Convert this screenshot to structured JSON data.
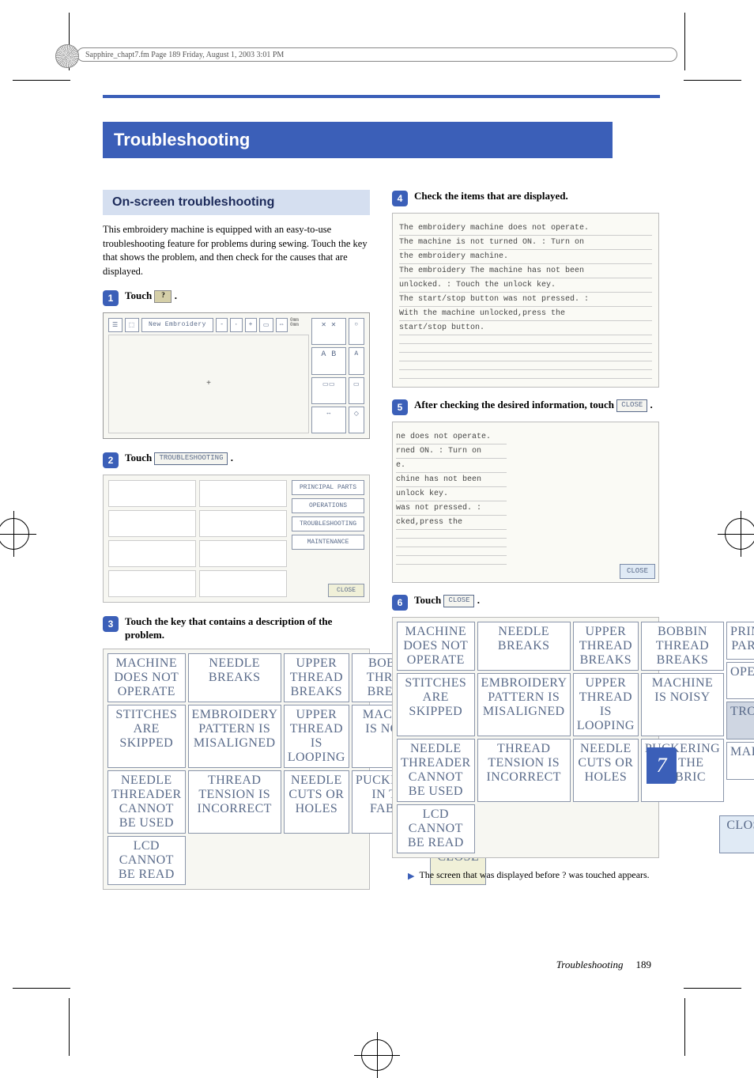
{
  "header_text": "Sapphire_chapt7.fm  Page 189  Friday, August 1, 2003  3:01 PM",
  "section_title": "Troubleshooting",
  "sub_heading": "On-screen troubleshooting",
  "intro": "This embroidery machine is equipped with an easy-to-use troubleshooting feature for problems during sewing. Touch the key that shows the problem, and then check for the causes that are displayed.",
  "steps": {
    "s1": {
      "label": "Touch",
      "button": "?",
      "suffix": "."
    },
    "s2": {
      "label": "Touch",
      "button": "TROUBLESHOOTING",
      "suffix": "."
    },
    "s3": {
      "label": "Touch the key that contains a description of the problem."
    },
    "s4": {
      "label": "Check the items that are displayed."
    },
    "s5": {
      "label": "After checking the desired information, touch",
      "button": "CLOSE",
      "suffix": "."
    },
    "s6": {
      "label": "Touch",
      "button": "CLOSE",
      "suffix": "."
    }
  },
  "menu_buttons": {
    "principal_parts": "PRINCIPAL PARTS",
    "operations": "OPERATIONS",
    "troubleshooting": "TROUBLESHOOTING",
    "maintenance": "MAINTENANCE",
    "close": "CLOSE"
  },
  "problem_keys": [
    "MACHINE DOES NOT OPERATE",
    "NEEDLE BREAKS",
    "UPPER THREAD BREAKS",
    "BOBBIN THREAD BREAKS",
    "STITCHES ARE SKIPPED",
    "EMBROIDERY PATTERN IS MISALIGNED",
    "UPPER THREAD IS LOOPING",
    "MACHINE IS NOISY",
    "NEEDLE THREADER CANNOT BE USED",
    "THREAD TENSION IS INCORRECT",
    "NEEDLE CUTS OR HOLES",
    "PUCKERING IN THE FABRIC",
    "LCD CANNOT BE READ"
  ],
  "messages_full": [
    "The embroidery machine does not operate.",
    "The machine is not turned ON. : Turn on",
    "the embroidery machine.",
    "The embroidery The machine has not been",
    "unlocked. : Touch the unlock key.",
    "The start/stop button was not pressed. :",
    "With the machine unlocked,press the",
    "start/stop button."
  ],
  "messages_partial": [
    "ne does not operate.",
    "rned ON. : Turn on",
    "e.",
    "chine has not been",
    " unlock key.",
    " was not pressed. :",
    "cked,press the"
  ],
  "close_label": "CLOSE",
  "result_note": "The screen that was displayed before       was touched appears.",
  "tab_number": "7",
  "footer": {
    "title": "Troubleshooting",
    "page": "189"
  },
  "screen_labels": {
    "new_emb": "New Embroidery",
    "zero": "0mm"
  }
}
